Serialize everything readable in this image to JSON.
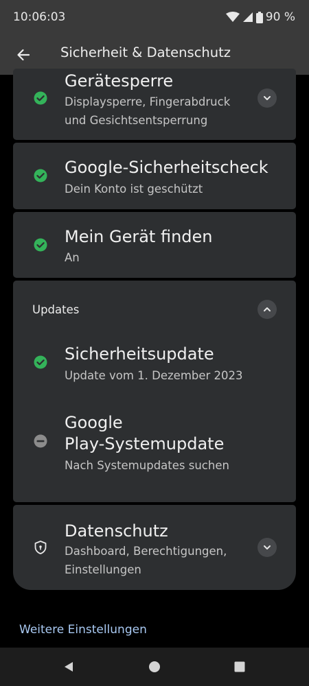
{
  "status_bar": {
    "time": "10:06:03",
    "battery": "90 %"
  },
  "app_bar": {
    "title": "Sicherheit & Datenschutz"
  },
  "items": [
    {
      "title": "Gerätesperre",
      "subtitle_line1": "Displaysperre, Fingerabdruck",
      "subtitle_line2": "und Gesichtsentsperrung",
      "status": "ok"
    },
    {
      "title": "Google-Sicherheitscheck",
      "subtitle": "Dein Konto ist geschützt",
      "status": "ok"
    },
    {
      "title": "Mein Gerät finden",
      "subtitle": "An",
      "status": "ok"
    }
  ],
  "updates": {
    "label": "Updates",
    "items": [
      {
        "title": "Sicherheitsupdate",
        "subtitle": "Update vom 1. Dezember 2023",
        "status": "ok"
      },
      {
        "title_line1": "Google",
        "title_line2": "Play-Systemupdate",
        "subtitle": "Nach Systemupdates suchen",
        "status": "neutral"
      }
    ]
  },
  "privacy": {
    "title": "Datenschutz",
    "subtitle_line1": "Dashboard, Berechtigungen,",
    "subtitle_line2": "Einstellungen"
  },
  "more_settings": "Weitere Einstellungen",
  "colors": {
    "ok": "#34b35a",
    "neutral": "#8c8c8c",
    "link": "#a9c9f2",
    "card": "#2d2f31",
    "bar": "#3a3a3a"
  }
}
